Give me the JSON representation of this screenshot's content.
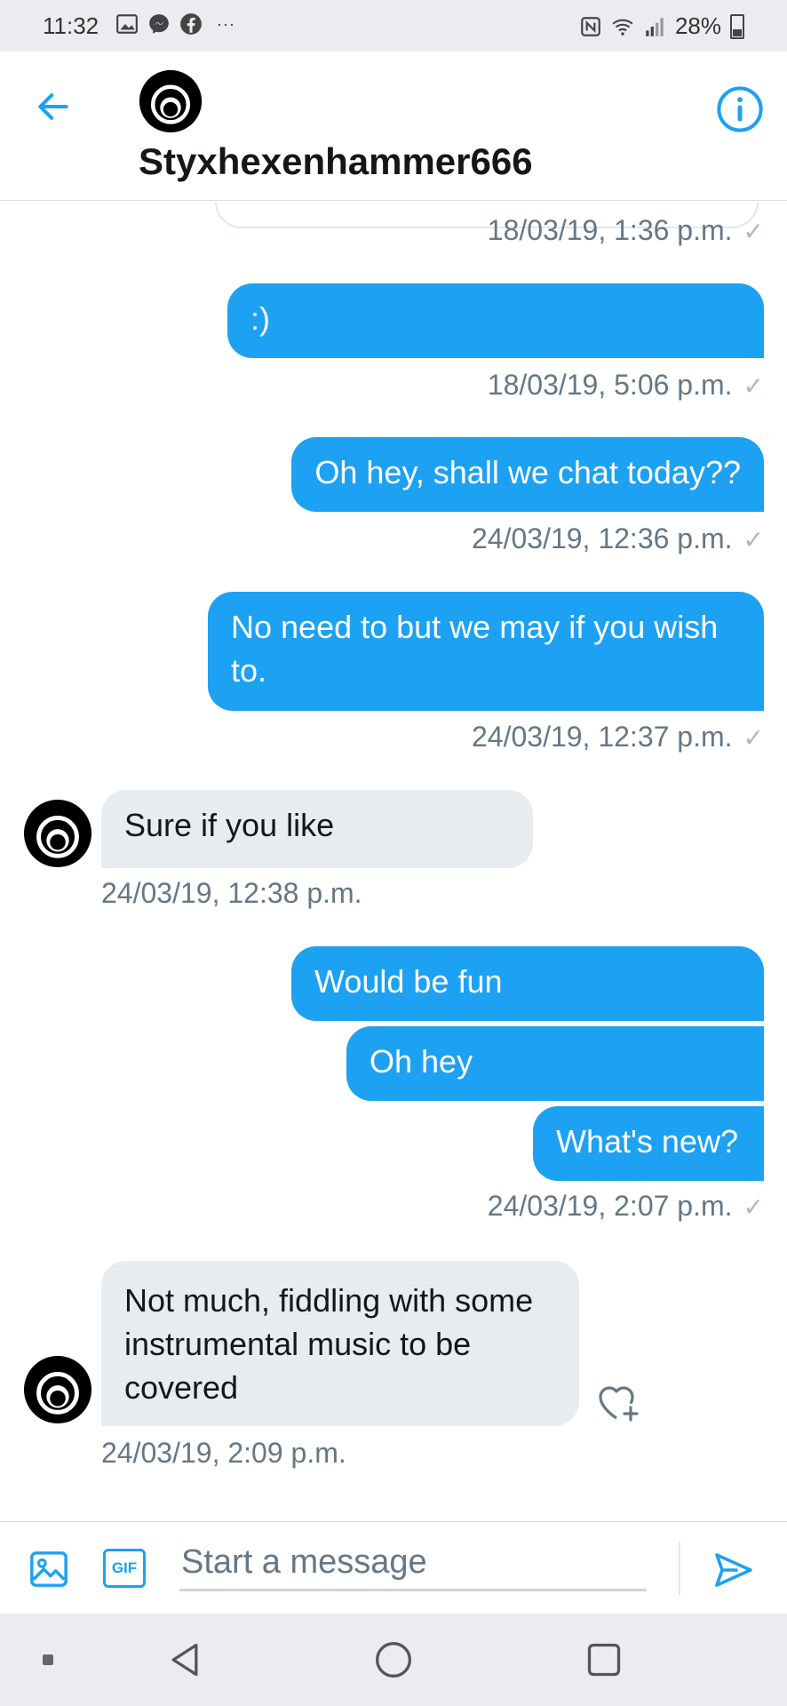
{
  "status_bar": {
    "time": "11:32",
    "left_icons": [
      "gallery-icon",
      "messenger-icon",
      "facebook-icon"
    ],
    "more": "···",
    "right_icons": [
      "nfc-icon",
      "wifi-icon",
      "signal-icon"
    ],
    "battery": "28%"
  },
  "header": {
    "contact_name": "Styxhexenhammer666",
    "accent_color": "#1da1f2"
  },
  "messages": [
    {
      "direction": "outgoing",
      "text": ":)",
      "timestamp": "18/03/19, 5:06 p.m."
    },
    {
      "direction": "outgoing",
      "text": "Oh hey, shall we chat today??",
      "timestamp": "24/03/19, 12:36 p.m."
    },
    {
      "direction": "outgoing",
      "text": "No need to but we may if you wish to.",
      "timestamp": "24/03/19, 12:37 p.m."
    },
    {
      "direction": "incoming",
      "text": "Sure if you like",
      "timestamp": "24/03/19, 12:38 p.m."
    },
    {
      "direction": "outgoing",
      "text": "Would be fun"
    },
    {
      "direction": "outgoing",
      "text": "Oh hey"
    },
    {
      "direction": "outgoing",
      "text": "What's new?",
      "timestamp": "24/03/19, 2:07 p.m."
    },
    {
      "direction": "incoming",
      "text": "Not much, fiddling with some instrumental music to be covered",
      "timestamp": "24/03/19, 2:09 p.m."
    }
  ],
  "earlier_timestamp": "18/03/19, 1:36 p.m.",
  "read_check": "✓",
  "composer": {
    "gif_label": "GIF",
    "placeholder": "Start a message"
  }
}
